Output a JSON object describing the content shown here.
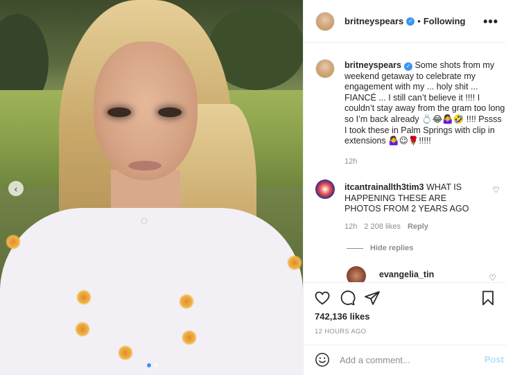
{
  "post": {
    "username": "britneyspears",
    "follow_status": "Following",
    "more_label": "•••",
    "photo_nav_label": "‹"
  },
  "caption": {
    "username": "britneyspears",
    "text": "Some shots from my weekend getaway to celebrate my engagement with my ... holy shit ... FIANCÉ ... I still can’t believe it !!!! I couldn’t stay away from the gram too long so I’m back already 💍😂🤷‍♀️🤣 !!!! Pssss I took these in Palm Springs with clip in extensions 🤷‍♀️😉🌹!!!!!",
    "time": "12h"
  },
  "comments": [
    {
      "username": "itcantrainallth3tim3",
      "text": "WHAT IS HAPPENING THESE ARE PHOTOS FROM 2 YEARS AGO",
      "time": "12h",
      "likes": "2 208 likes",
      "reply_label": "Reply"
    }
  ],
  "hide_replies_label": "Hide replies",
  "reply_comment": {
    "username": "evangelia_tin"
  },
  "stats": {
    "likes": "742,136 likes",
    "posted": "12 HOURS AGO"
  },
  "add_comment": {
    "placeholder": "Add a comment...",
    "post_label": "Post"
  },
  "colors": {
    "accent": "#3897f0",
    "post_disabled": "#b2dffc",
    "muted": "#8e8e8e",
    "text": "#262626"
  },
  "icons": [
    "heart-icon",
    "comment-icon",
    "share-icon",
    "bookmark-icon",
    "emoji-icon",
    "verified-badge-icon",
    "more-options-icon"
  ]
}
